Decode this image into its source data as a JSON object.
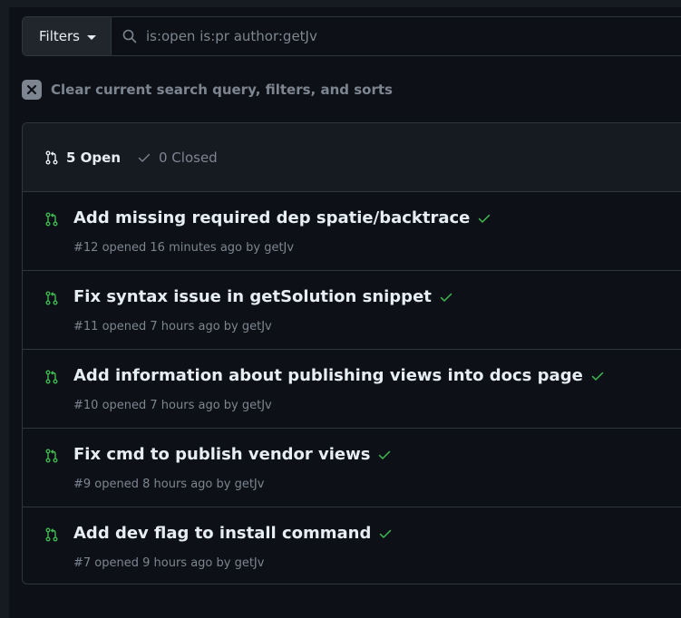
{
  "search": {
    "filters_label": "Filters",
    "query": "is:open is:pr author:getJv"
  },
  "clear_label": "Clear current search query, filters, and sorts",
  "tabs": {
    "open_label": "5 Open",
    "closed_label": "0 Closed"
  },
  "pull_requests": [
    {
      "title": "Add missing required dep spatie/backtrace",
      "meta": "#12 opened 16 minutes ago by getJv"
    },
    {
      "title": "Fix syntax issue in getSolution snippet",
      "meta": "#11 opened 7 hours ago by getJv"
    },
    {
      "title": "Add information about publishing views into docs page",
      "meta": "#10 opened 7 hours ago by getJv"
    },
    {
      "title": "Fix cmd to publish vendor views",
      "meta": "#9 opened 8 hours ago by getJv"
    },
    {
      "title": "Add dev flag to install command",
      "meta": "#7 opened 9 hours ago by getJv"
    }
  ],
  "colors": {
    "open_icon": "#3fb950",
    "check": "#3fb950",
    "muted": "#7d8590"
  }
}
